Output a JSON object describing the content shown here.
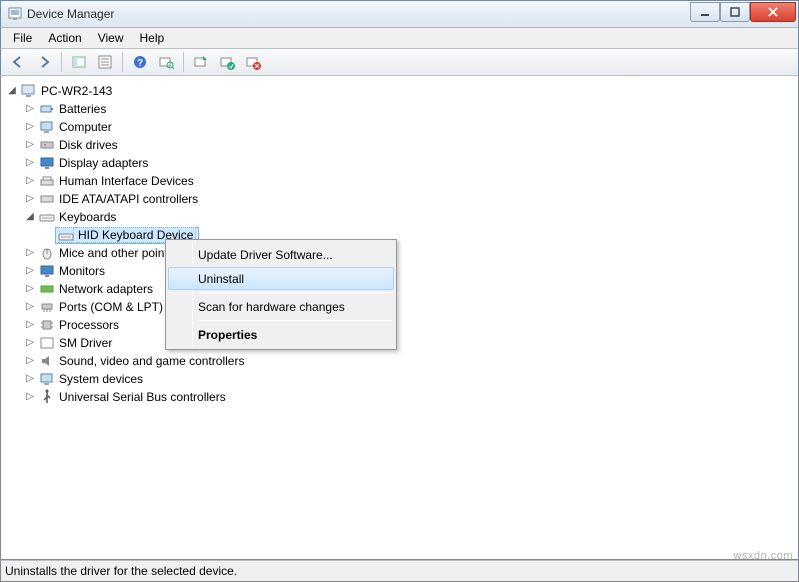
{
  "window": {
    "title": "Device Manager"
  },
  "menu": {
    "file": "File",
    "action": "Action",
    "view": "View",
    "help": "Help"
  },
  "tree": {
    "root": "PC-WR2-143",
    "batteries": "Batteries",
    "computer": "Computer",
    "disk_drives": "Disk drives",
    "display_adapters": "Display adapters",
    "hid": "Human Interface Devices",
    "ide": "IDE ATA/ATAPI controllers",
    "keyboards": "Keyboards",
    "hid_keyboard": "HID Keyboard Device",
    "mice": "Mice and other pointing devices",
    "monitors": "Monitors",
    "network": "Network adapters",
    "ports": "Ports (COM & LPT)",
    "processors": "Processors",
    "sm_driver": "SM Driver",
    "sound": "Sound, video and game controllers",
    "system": "System devices",
    "usb": "Universal Serial Bus controllers"
  },
  "context_menu": {
    "update": "Update Driver Software...",
    "uninstall": "Uninstall",
    "scan": "Scan for hardware changes",
    "properties": "Properties"
  },
  "status": "Uninstalls the driver for the selected device.",
  "watermark": "wsxdn.com"
}
